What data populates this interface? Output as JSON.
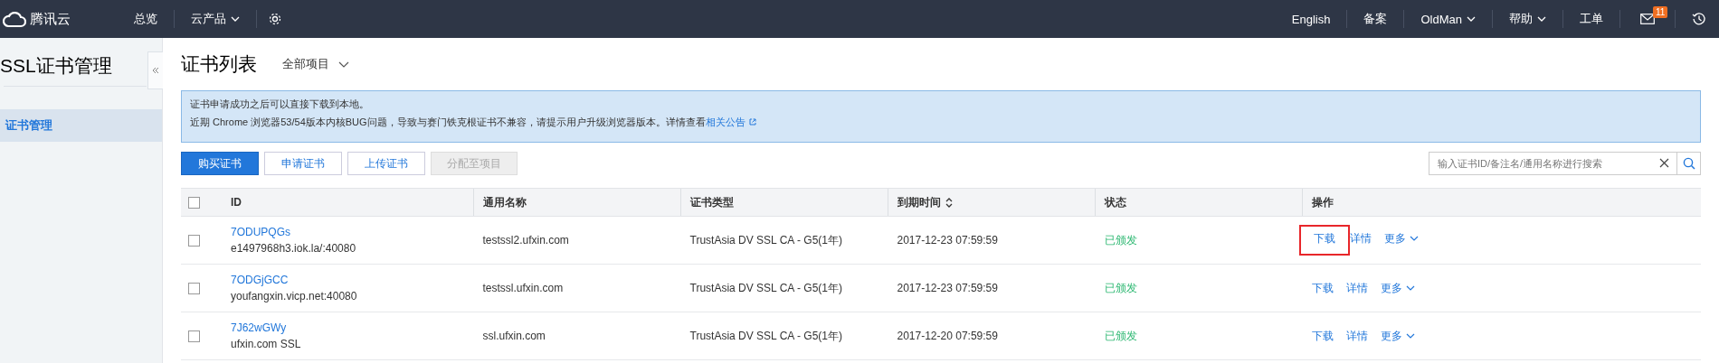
{
  "topbar": {
    "logo": "腾讯云",
    "nav_left": [
      {
        "label": "总览",
        "dropdown": false
      },
      {
        "label": "云产品",
        "dropdown": true
      }
    ],
    "nav_right": [
      {
        "label": "English",
        "dropdown": false
      },
      {
        "label": "备案",
        "dropdown": false
      },
      {
        "label": "OldMan",
        "dropdown": true
      },
      {
        "label": "帮助",
        "dropdown": true
      },
      {
        "label": "工单",
        "dropdown": false
      }
    ],
    "mail_badge": "11"
  },
  "sidebar": {
    "title": "SSL证书管理",
    "items": [
      {
        "label": "证书管理",
        "selected": true
      }
    ]
  },
  "page": {
    "title": "证书列表",
    "project_filter": "全部项目"
  },
  "notice": {
    "lines": [
      "证书申请成功之后可以直接下载到本地。",
      "近期 Chrome 浏览器53/54版本内核BUG问题，导致与赛门铁克根证书不兼容，请提示用户升级浏览器版本。详情查看"
    ],
    "link": "相关公告"
  },
  "toolbar": {
    "buttons": [
      {
        "label": "购买证书",
        "kind": "primary",
        "disabled": false
      },
      {
        "label": "申请证书",
        "kind": "default",
        "disabled": false
      },
      {
        "label": "上传证书",
        "kind": "default",
        "disabled": false
      },
      {
        "label": "分配至项目",
        "kind": "default",
        "disabled": true
      }
    ],
    "search": {
      "placeholder": "输入证书ID/备注名/通用名称进行搜索"
    }
  },
  "table": {
    "select_all": {
      "checked": false
    },
    "columns": [
      {
        "label": "ID",
        "sortable": false
      },
      {
        "label": "通用名称",
        "sortable": false
      },
      {
        "label": "证书类型",
        "sortable": false
      },
      {
        "label": "到期时间",
        "sortable": true
      },
      {
        "label": "状态",
        "sortable": false
      },
      {
        "label": "操作",
        "sortable": false
      }
    ],
    "rows": [
      {
        "checked": false,
        "id": "7ODUPQGs",
        "remark": "e1497968h3.iok.la/:40080",
        "common_name": "testssl2.ufxin.com",
        "type": "TrustAsia DV SSL CA - G5(1年)",
        "expires": "2017-12-23 07:59:59",
        "status": "已颁发",
        "actions": [
          "下载",
          "详情",
          "更多"
        ],
        "highlighted": true
      },
      {
        "checked": false,
        "id": "7ODGjGCC",
        "remark": "youfangxin.vicp.net:40080",
        "common_name": "testssl.ufxin.com",
        "type": "TrustAsia DV SSL CA - G5(1年)",
        "expires": "2017-12-23 07:59:59",
        "status": "已颁发",
        "actions": [
          "下载",
          "详情",
          "更多"
        ],
        "highlighted": false
      },
      {
        "checked": false,
        "id": "7J62wGWy",
        "remark": "ufxin.com SSL",
        "common_name": "ssl.ufxin.com",
        "type": "TrustAsia DV SSL CA - G5(1年)",
        "expires": "2017-12-20 07:59:59",
        "status": "已颁发",
        "actions": [
          "下载",
          "详情",
          "更多"
        ],
        "highlighted": false
      }
    ]
  }
}
